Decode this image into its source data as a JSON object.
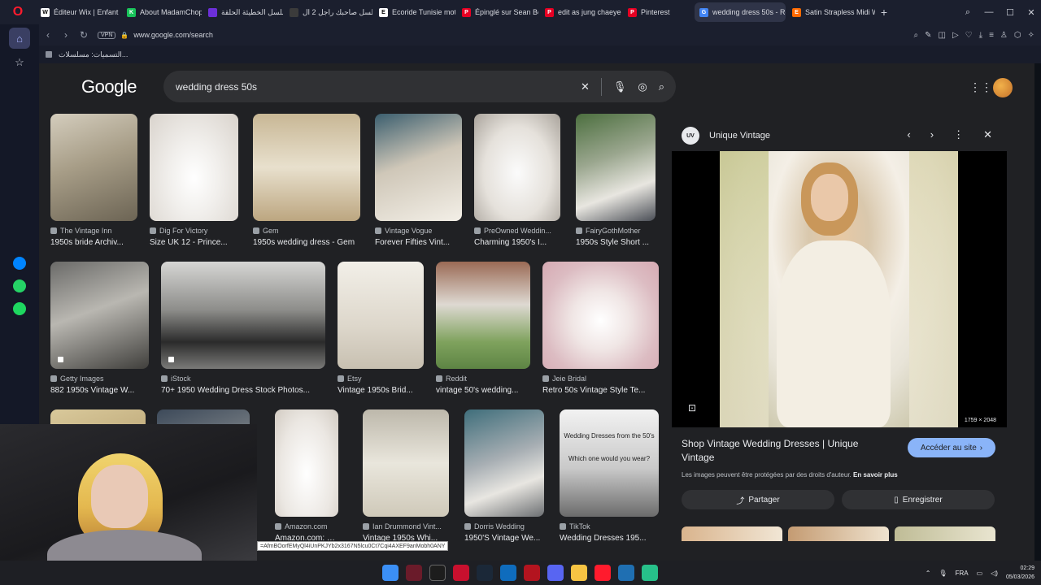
{
  "browser": {
    "tabs": [
      {
        "label": "Éditeur Wix | Enfant Do...",
        "color": "#ffffff",
        "text": "W"
      },
      {
        "label": "About MadamChopin",
        "color": "#18c35a",
        "text": "K"
      },
      {
        "label": "مسلسل الخطيئة الحلقة",
        "color": "#6c2fd9",
        "text": ""
      },
      {
        "label": "مسلسل صاحبك راجل 2 ال...",
        "color": "#3b3b3b",
        "text": ""
      },
      {
        "label": "Ecoride Tunisie moto et",
        "color": "#ffffff",
        "text": "E"
      },
      {
        "label": "Épinglé sur Sean Bean",
        "color": "#e60023",
        "text": "P"
      },
      {
        "label": "edit as jung chaeyeon b",
        "color": "#e60023",
        "text": "P"
      },
      {
        "label": "Pinterest",
        "color": "#e60023",
        "text": "P"
      },
      {
        "label": "wedding dress 50s - Rech",
        "color": "#4285f4",
        "text": "G"
      },
      {
        "label": "Satin Strapless Midi We",
        "color": "#ff6a00",
        "text": "E"
      }
    ],
    "active_tab_index": 8,
    "url": "www.google.com/search",
    "vpn_label": "VPN",
    "bookmark": "التسميات: مسلسلات..."
  },
  "google": {
    "logo": "Google",
    "query": "wedding dress 50s"
  },
  "results_row1": [
    {
      "source": "The Vintage Inn",
      "title": "1950s bride Archiv..."
    },
    {
      "source": "Dig For Victory",
      "title": "Size UK 12 - Prince..."
    },
    {
      "source": "Gem",
      "title": "1950s wedding dress - Gem"
    },
    {
      "source": "Vintage Vogue",
      "title": "Forever Fifties Vint..."
    },
    {
      "source": "PreOwned Weddin...",
      "title": "Charming 1950's I..."
    },
    {
      "source": "FairyGothMother",
      "title": "1950s Style Short ..."
    }
  ],
  "results_row2": [
    {
      "source": "Getty Images",
      "title": "882 1950s Vintage W..."
    },
    {
      "source": "iStock",
      "title": "70+ 1950 Wedding Dress Stock Photos..."
    },
    {
      "source": "Etsy",
      "title": "Vintage 1950s Brid..."
    },
    {
      "source": "Reddit",
      "title": "vintage 50's wedding..."
    },
    {
      "source": "Jeie Bridal",
      "title": "Retro 50s Vintage Style Te..."
    }
  ],
  "results_row3": [
    {
      "source": "Amazon.com",
      "title": "Amazon.com: Mau..."
    },
    {
      "source": "Ian Drummond Vint...",
      "title": "Vintage 1950s Whi..."
    },
    {
      "source": "Dorris Wedding",
      "title": "1950'S Vintage We..."
    },
    {
      "source": "TikTok",
      "title": "Wedding Dresses 195..."
    }
  ],
  "tiktok_overlay": {
    "line1": "Wedding Dresses from the 50's",
    "line2": "Which one would you wear?"
  },
  "preview": {
    "site_logo": "UV",
    "site": "Unique Vintage",
    "dimensions": "1759 × 2048",
    "title": "Shop Vintage Wedding Dresses | Unique Vintage",
    "visit_label": "Accéder au site",
    "copyright": "Les images peuvent être protégées par des droits d'auteur.",
    "learn_more": "En savoir plus",
    "share_label": "Partager",
    "save_label": "Enregistrer"
  },
  "status_url": "=AfmBOorfEMyQl4iUnPKJYb2x3167N5lcu0Ct7Cqi4AXEF9anMobh0ANY",
  "taskbar": {
    "language": "FRA",
    "time": "02:29",
    "date": "05/03/2026"
  }
}
